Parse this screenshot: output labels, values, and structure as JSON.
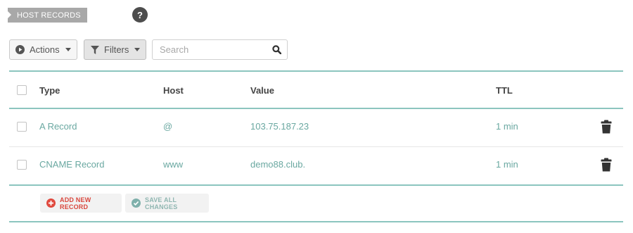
{
  "section": {
    "title": "HOST RECORDS",
    "help_icon": "question-mark"
  },
  "toolbar": {
    "actions_label": "Actions",
    "filters_label": "Filters",
    "search_placeholder": "Search",
    "search_value": ""
  },
  "table": {
    "headers": {
      "type": "Type",
      "host": "Host",
      "value": "Value",
      "ttl": "TTL"
    },
    "rows": [
      {
        "type": "A Record",
        "host": "@",
        "value": "103.75.187.23",
        "ttl": "1 min"
      },
      {
        "type": "CNAME Record",
        "host": "www",
        "value": "demo88.club.",
        "ttl": "1 min"
      }
    ]
  },
  "footer": {
    "add_label": "ADD NEW RECORD",
    "save_label": "SAVE ALL CHANGES"
  },
  "colors": {
    "accent_teal": "#8cc5bf",
    "value_text": "#6aa8a1",
    "add_red": "#d9463c",
    "save_disabled": "#8fb6b1"
  }
}
